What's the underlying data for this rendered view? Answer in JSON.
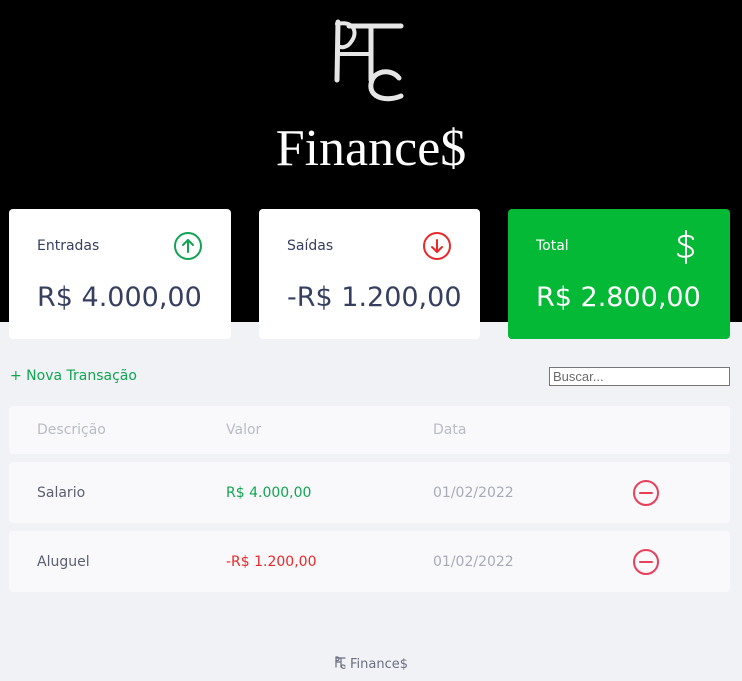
{
  "header": {
    "logo_text": "PTC",
    "brand": "Finance$"
  },
  "cards": {
    "income": {
      "label": "Entradas",
      "value": "R$ 4.000,00",
      "icon": "arrow-up-circle-icon"
    },
    "expense": {
      "label": "Saídas",
      "value": "-R$ 1.200,00",
      "icon": "arrow-down-circle-icon"
    },
    "total": {
      "label": "Total",
      "value": "R$ 2.800,00",
      "icon": "dollar-sign-icon"
    }
  },
  "actions": {
    "new_transaction": "+ Nova Transação",
    "search_placeholder": "Buscar..."
  },
  "table": {
    "headers": {
      "description": "Descrição",
      "amount": "Valor",
      "date": "Data"
    },
    "rows": [
      {
        "description": "Salario",
        "amount": "R$ 4.000,00",
        "date": "01/02/2022",
        "type": "income"
      },
      {
        "description": "Aluguel",
        "amount": "-R$ 1.200,00",
        "date": "01/02/2022",
        "type": "expense"
      }
    ]
  },
  "footer": {
    "text": "Finance$"
  },
  "colors": {
    "header_bg": "#000000",
    "page_bg": "#f0f2f5",
    "income_green": "#12a454",
    "total_green": "#03b935",
    "expense_red": "#e92929",
    "text_dark": "#363f5f"
  }
}
